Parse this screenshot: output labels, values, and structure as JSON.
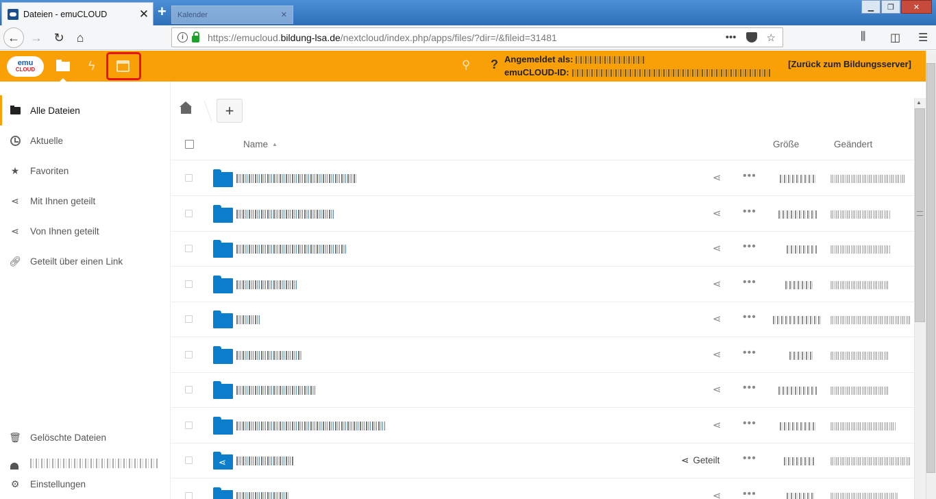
{
  "browser": {
    "tab_title": "Dateien - emuCLOUD",
    "tab_close": "✕",
    "new_tab": "+",
    "inactive_tab_title": "Kalender",
    "inactive_tab_close": "✕",
    "url_prefix": "https://emucloud.",
    "url_domain": "bildung-lsa.de",
    "url_path": "/nextcloud/index.php/apps/files/?dir=/&fileid=31481",
    "url_more": "•••"
  },
  "header": {
    "logged_in_label": "Angemeldet als:",
    "cloud_id_label": "emuCLOUD-ID:",
    "back_link": "[Zurück zum Bildungsserver]",
    "help": "?"
  },
  "sidebar": {
    "items": [
      {
        "label": "Alle Dateien",
        "icon": "folder-icon"
      },
      {
        "label": "Aktuelle",
        "icon": "clock-icon"
      },
      {
        "label": "Favoriten",
        "icon": "star-icon"
      },
      {
        "label": "Mit Ihnen geteilt",
        "icon": "share-icon"
      },
      {
        "label": "Von Ihnen geteilt",
        "icon": "share-icon"
      },
      {
        "label": "Geteilt über einen Link",
        "icon": "link-icon"
      }
    ],
    "deleted": "Gelöschte Dateien",
    "settings": "Einstellungen"
  },
  "files": {
    "add_button": "+",
    "columns": {
      "name": "Name",
      "size": "Größe",
      "modified": "Geändert"
    },
    "shared_label": "Geteilt",
    "more": "•••"
  },
  "colors": {
    "header_orange": "#f9a006",
    "folder_blue": "#0b7dcb",
    "highlight_red": "#e5141b"
  }
}
